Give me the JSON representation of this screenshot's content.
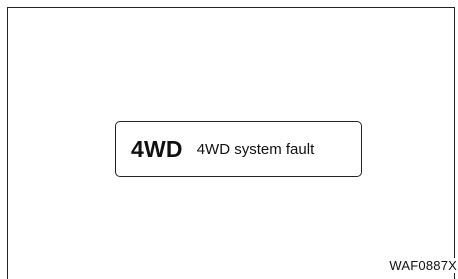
{
  "display": {
    "indicator": "4WD",
    "message": "4WD system fault"
  },
  "figure_code": "WAF0887X"
}
